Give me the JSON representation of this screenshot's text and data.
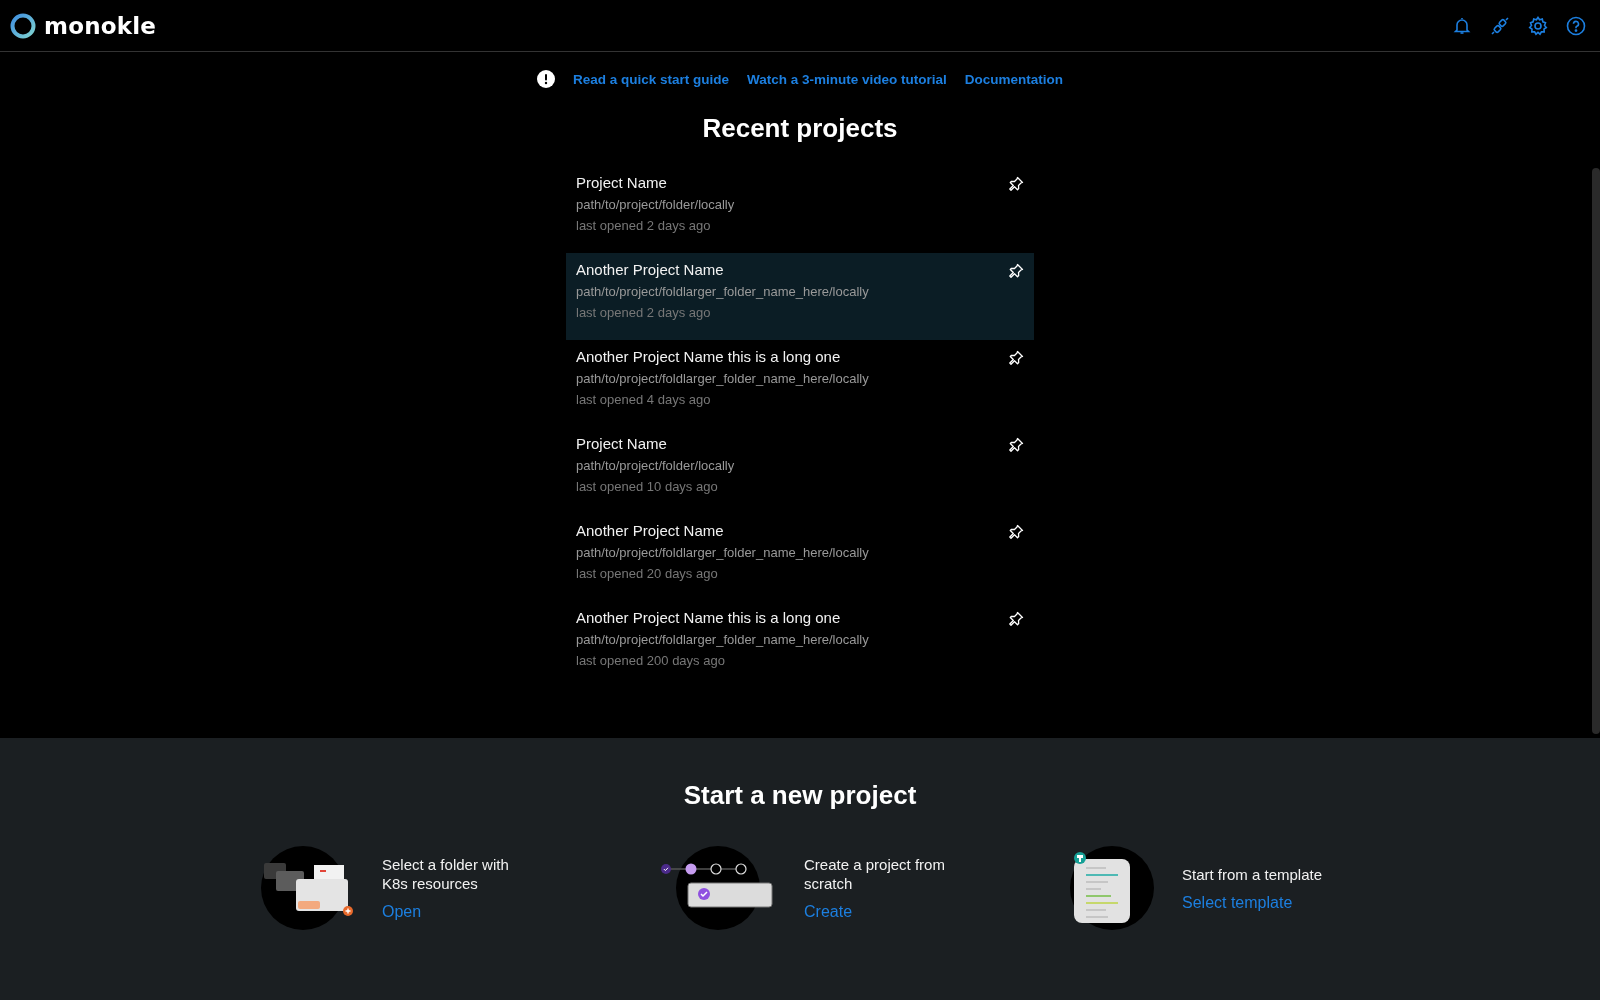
{
  "app": {
    "logo_text": "monokle"
  },
  "help_links": [
    {
      "label": "Read a quick start guide"
    },
    {
      "label": "Watch a 3-minute video tutorial"
    },
    {
      "label": "Documentation"
    }
  ],
  "recent_projects": {
    "title": "Recent projects",
    "items": [
      {
        "name": "Project Name",
        "path": "path/to/project/folder/locally",
        "last_opened": "last opened 2 days ago",
        "selected": false
      },
      {
        "name": "Another Project Name",
        "path": "path/to/project/foldlarger_folder_name_here/locally",
        "last_opened": "last opened 2 days ago",
        "selected": true
      },
      {
        "name": "Another Project Name this is a long one",
        "path": "path/to/project/foldlarger_folder_name_here/locally",
        "last_opened": "last opened 4 days ago",
        "selected": false
      },
      {
        "name": "Project Name",
        "path": "path/to/project/folder/locally",
        "last_opened": "last opened 10 days ago",
        "selected": false
      },
      {
        "name": "Another Project Name",
        "path": "path/to/project/foldlarger_folder_name_here/locally",
        "last_opened": "last opened 20 days ago",
        "selected": false
      },
      {
        "name": "Another Project Name this is a long one",
        "path": "path/to/project/foldlarger_folder_name_here/locally",
        "last_opened": "last opened 200 days ago",
        "selected": false
      }
    ]
  },
  "new_project": {
    "title": "Start a new project",
    "options": [
      {
        "kind": "folder",
        "description": "Select a folder with K8s resources",
        "action": "Open"
      },
      {
        "kind": "scratch",
        "description": "Create a project from scratch",
        "action": "Create"
      },
      {
        "kind": "template",
        "description": "Start from a template",
        "action": "Select template"
      }
    ]
  }
}
